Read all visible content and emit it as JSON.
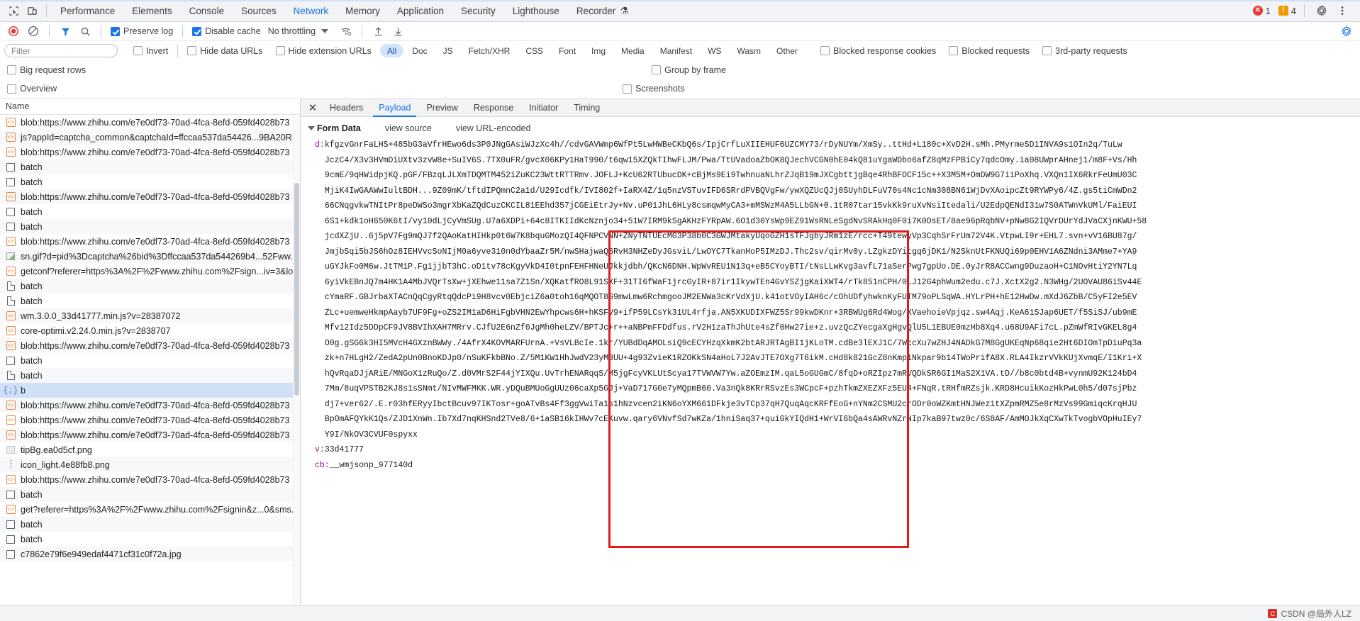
{
  "topbar": {
    "icons": [
      {
        "name": "inspect-element-icon",
        "glyph": "⬚"
      },
      {
        "name": "device-toolbar-icon",
        "glyph": "▯"
      }
    ],
    "tabs": [
      {
        "label": "Performance",
        "active": false
      },
      {
        "label": "Elements",
        "active": false
      },
      {
        "label": "Console",
        "active": false
      },
      {
        "label": "Sources",
        "active": false
      },
      {
        "label": "Network",
        "active": true
      },
      {
        "label": "Memory",
        "active": false
      },
      {
        "label": "Application",
        "active": false
      },
      {
        "label": "Security",
        "active": false
      },
      {
        "label": "Lighthouse",
        "active": false
      },
      {
        "label": "Recorder",
        "active": false,
        "flask": "⚗"
      }
    ],
    "error_count": "1",
    "warning_count": "4",
    "settings_icon": "gear-icon",
    "more_icon": "more-vertical-icon"
  },
  "toolbar": {
    "record_icon": "record-button",
    "clear_icon": "clear-network-log-icon",
    "filter_icon": "filter-icon",
    "search_icon": "search-icon",
    "preserve_log_label": "Preserve log",
    "preserve_log_checked": true,
    "disable_cache_label": "Disable cache",
    "disable_cache_checked": true,
    "throttle_value": "No throttling",
    "network_conditions_icon": "wifi-settings-icon",
    "import_har_icon": "import-har-icon",
    "export_har_icon": "export-har-icon",
    "settings_icon": "network-settings-icon"
  },
  "filters": {
    "placeholder": "Filter",
    "invert_label": "Invert",
    "invert_checked": false,
    "hide_data_urls_label": "Hide data URLs",
    "hide_data_urls_checked": false,
    "hide_extension_urls_label": "Hide extension URLs",
    "hide_extension_urls_checked": false,
    "types": [
      {
        "label": "All",
        "active": true
      },
      {
        "label": "Doc",
        "active": false
      },
      {
        "label": "JS",
        "active": false
      },
      {
        "label": "Fetch/XHR",
        "active": false
      },
      {
        "label": "CSS",
        "active": false
      },
      {
        "label": "Font",
        "active": false
      },
      {
        "label": "Img",
        "active": false
      },
      {
        "label": "Media",
        "active": false
      },
      {
        "label": "Manifest",
        "active": false
      },
      {
        "label": "WS",
        "active": false
      },
      {
        "label": "Wasm",
        "active": false
      },
      {
        "label": "Other",
        "active": false
      }
    ],
    "blocked_response_cookies_label": "Blocked response cookies",
    "blocked_response_cookies_checked": false,
    "blocked_requests_label": "Blocked requests",
    "blocked_requests_checked": false,
    "third_party_requests_label": "3rd-party requests",
    "third_party_requests_checked": false,
    "big_request_rows_label": "Big request rows",
    "big_request_rows_checked": false,
    "group_by_frame_label": "Group by frame",
    "group_by_frame_checked": false,
    "overview_label": "Overview",
    "overview_checked": false,
    "screenshots_label": "Screenshots",
    "screenshots_checked": false
  },
  "requests": {
    "column_header": "Name",
    "rows": [
      {
        "name": "blob:https://www.zhihu.com/e7e0df73-70ad-4fca-8efd-059fd4028b73",
        "icon": "js-file-icon",
        "selected": false
      },
      {
        "name": "js?appId=captcha_common&captchaId=ffccaa537da54426...9BA20R...",
        "icon": "js-file-icon",
        "selected": false
      },
      {
        "name": "blob:https://www.zhihu.com/e7e0df73-70ad-4fca-8efd-059fd4028b73",
        "icon": "js-file-icon",
        "selected": false
      },
      {
        "name": "batch",
        "icon": "square-icon",
        "selected": false
      },
      {
        "name": "batch",
        "icon": "square-icon",
        "selected": false
      },
      {
        "name": "blob:https://www.zhihu.com/e7e0df73-70ad-4fca-8efd-059fd4028b73",
        "icon": "js-file-icon",
        "selected": false
      },
      {
        "name": "batch",
        "icon": "square-icon",
        "selected": false
      },
      {
        "name": "batch",
        "icon": "square-icon",
        "selected": false
      },
      {
        "name": "blob:https://www.zhihu.com/e7e0df73-70ad-4fca-8efd-059fd4028b73",
        "icon": "js-file-icon",
        "selected": false
      },
      {
        "name": "sn.gif?d=pid%3Dcaptcha%26bid%3Dffccaa537da544269b4...52Fww...",
        "icon": "image-file-icon",
        "selected": false
      },
      {
        "name": "getconf?referer=https%3A%2F%2Fwww.zhihu.com%2Fsign...iv=3&lo...",
        "icon": "js-file-icon",
        "selected": false
      },
      {
        "name": "batch",
        "icon": "doc-file-icon",
        "selected": false
      },
      {
        "name": "batch",
        "icon": "doc-file-icon",
        "selected": false
      },
      {
        "name": "wm.3.0.0_33d41777.min.js?v=28387072",
        "icon": "js-file-icon",
        "selected": false
      },
      {
        "name": "core-optimi.v2.24.0.min.js?v=2838707",
        "icon": "js-file-icon",
        "selected": false
      },
      {
        "name": "blob:https://www.zhihu.com/e7e0df73-70ad-4fca-8efd-059fd4028b73",
        "icon": "js-file-icon",
        "selected": false
      },
      {
        "name": "batch",
        "icon": "square-icon",
        "selected": false
      },
      {
        "name": "batch",
        "icon": "doc-file-icon",
        "selected": false
      },
      {
        "name": "b",
        "icon": "websocket-icon",
        "selected": true
      },
      {
        "name": "blob:https://www.zhihu.com/e7e0df73-70ad-4fca-8efd-059fd4028b73",
        "icon": "js-file-icon",
        "selected": false
      },
      {
        "name": "blob:https://www.zhihu.com/e7e0df73-70ad-4fca-8efd-059fd4028b73",
        "icon": "js-file-icon",
        "selected": false
      },
      {
        "name": "blob:https://www.zhihu.com/e7e0df73-70ad-4fca-8efd-059fd4028b73",
        "icon": "js-file-icon",
        "selected": false
      },
      {
        "name": "tipBg.ea0d5cf.png",
        "icon": "picture-file-icon",
        "selected": false
      },
      {
        "name": "icon_light.4e88fb8.png",
        "icon": "dots-file-icon",
        "selected": false
      },
      {
        "name": "blob:https://www.zhihu.com/e7e0df73-70ad-4fca-8efd-059fd4028b73",
        "icon": "js-file-icon",
        "selected": false
      },
      {
        "name": "batch",
        "icon": "square-icon",
        "selected": false
      },
      {
        "name": "get?referer=https%3A%2F%2Fwww.zhihu.com%2Fsignin&z...0&sms...",
        "icon": "js-file-icon",
        "selected": false
      },
      {
        "name": "batch",
        "icon": "square-icon",
        "selected": false
      },
      {
        "name": "batch",
        "icon": "square-icon",
        "selected": false
      },
      {
        "name": "c7862e79f6e949edaf4471cf31c0f72a.jpg",
        "icon": "square-icon",
        "selected": false
      }
    ]
  },
  "details": {
    "close_icon": "close-icon",
    "tabs": [
      {
        "label": "Headers",
        "active": false
      },
      {
        "label": "Payload",
        "active": true
      },
      {
        "label": "Preview",
        "active": false
      },
      {
        "label": "Response",
        "active": false
      },
      {
        "label": "Initiator",
        "active": false
      },
      {
        "label": "Timing",
        "active": false
      }
    ],
    "form_data_title": "Form Data",
    "view_source_label": "view source",
    "view_url_encoded_label": "view URL-encoded",
    "fields": [
      {
        "key": "d:",
        "lines": [
          "kfgzvGnrFaLHS+485bG3aVfrHEwo6ds3P0JNgGAsiWJzXc4h//cdvGAVWmp6WfPt5LwHWBeCKbQ6s/IpjCrfLuXIIEHUF6UZCMY73/rDyNUYm/XmSy..ttHd+L180c+XvD2H.sMh.PMyrmeSD1INVA9s1OIn2q/TuLw",
          "JczC4/X3v3HVmDiUXtv3zvW8e+SuIV6S.7TX0uFR/gvcX06KPy1HaT990/t6qw15XZQkTIhwFLJM/Pwa/TtUVadoaZbOK8QJechVCGN0hE04kQ81uYgaWDbo6afZ8qMzFPBiCy7qdcOmy.ia08UWprAHnej1/m8F+Vs/Hh",
          "9cmE/9qHWidpjKQ.pGF/FBzqLJLXmTDQMTM452iZuKC23WttRTTRmv.JOFLJ+KcU62RTUbucDK+cBjMs9Ei9TwhnuaNLhrZJqB19mJXCgbttjgBqe4RhBFOCF15c++X3M5M+OmDW9G7iiPoXhq.VXQn1IX6RkrFeUmU03C",
          "MjiK4IwGAAWwIultBDH...9Z09mK/tftdIPQmnC2a1d/U29Icdfk/IVI802f+IaRX4Z/1q5nzVSTuvIFD6SRrdPVBQVgFw/ywXQZUcQJj0SUyhDLFuV70s4Nc1cNm308BN61WjDvXAoipcZt9RYWPy6/4Z.gs5tiCmWDn2",
          "66CNqgvkwTNItPr8peDWSo3mgrXbKaZQdCuzCKCIL81EEhd357jCGEiEtrJy+Nv.uP01JhL6HLy8csmqwMyCA3+mMSWzM4A5LLbGN+0.1tR07tar15vkKk9ruXvNsiItedali/U2EdpQENdI31w7S0ATWnVkUMl/FaiEUI",
          "6S1+kdk1oH650K6tI/vy10dLjCyVmSUg.U7a6XDPi+64c8ITKIIdKcNznjo34+51W7IRM9kSgAKHzFYRpAW.6O1d30YsWp9EZ91WsRNLeSgdNvSRAkHq0F0i7K0OsET/8ae96pRqbNV+pNw8G2IQVrDUrYdJVaCXjnKWU+58",
          "jcdXZjU..6j5pV7Fg9mQJ7f2QAoKatHIHkp0t6W7K8bquGMozQI4QFNPCVNN+ZNyTNTUEcMG3P38b0C3GWJMtakyUqoGZH1sTFJgbyJRm1zE/rcc+T49tewyVp3CqhSrFrUm72V4K.VtpwLI9r+EHL7.svn+vV16BU87g/",
          "JmjbSqi5bJS6hOz8IEHVvcSoNIjM0a6yve310n0dYbaaZr5M/nwSHajwaQ6RvH3NHZeDyJGsviL/LwOYC7TkanHoP5IMzDJ.Thc2sv/qirMv0y.LZgkzDYitgq6jDK1/N2SknUtFKNUQi69p0EHV1A6ZNdni3AMme7+YA9",
          "uGYJkFo0M6w.JtTM1P.Fg1jjbT3hC.oD1tv78cKgyVkD4I0tpnFEHFHNeUJkkjdbh/QKcN6DNH.WpWvREU1N13q+eB5CYoyBTI/tNsLLwKvg3avfL71aSerPwg7gpUo.DE.0yJrR8ACCwng9DuzaoH+C1NOvHtiY2YN7Lq",
          "6yiVkEBnJQ7m4HK1A4MbJVQrTsXw+jXEhwe11sa7Z1Sn/XQKatfRO8L91SXF+31TI6fWaF1jrcGyIR+87ir1IkywTEn4GvYSZjgKaiXWT4/rTk851nCPH/0LJ12G4phWum2edu.c7J.XctX2g2.N3WHg/2UOVAU86iSv44E",
          "cYmaRF.GBJrbaXTACnQqCgyRtqQdcPi9H8vcv0EbjciZ6a0toh16qMQOT8S9mwLmw6RchmgooJM2ENWa3cKrVdXjU.k41otVOyIAH6c/cOhUDfyhwknKyFUTM79oPLSqWA.HYLrPH+hE12HwDw.mXdJ6ZbB/C5yFI2e5EV",
          "ZLc+uemweHkmpAayb7UF9Fg+oZS2IM1aD6HiFgbVHN2EwYhpcws6H+hKSFV9+ifP59LCsYk31UL4rfja.AN5XKUDIXFWZ5Sr99kwDKnr+3RBWUg6Rd4Wog/XVaehoieVpjqz.sw4Aqj.KeA61SJap6UET/f5SiSJ/ub9mE",
          "Mfv12Idz5DDpCF9JV8BVIhXAH7MRrv.CJfU2E6nZf0JgMh0heLZV/BPTJc+r++aNBPmFFDdfus.rV2H1zaThJhUte4sZf0Hw27ie+z.uvzQcZYecgaXgHgvQlU5L1EBUE0mzHb8Xq4.u68U9AFi7cL.pZmWfRIvGKEL8g4",
          "O0g.gSG6k3HI5MVcH4GXznBWWy./4AfrX4KOVMARFUrnA.+VsVLBcIe.1kr/YUBdDqAMOLsiQ9cECYHzqXkmK2btARJRTAgBI1jKLoTM.cdBe3lEXJ1C/7WccXu7wZHJ4NADkG7M8GgUKEqNp68qie2Ht6DIOmTpDiuPq3a",
          "zk+n7HLgH2/ZedA2pUn0BnoKDJp0/nSuKFkbBNo.Z/5M1KW1HhJwdV23yM8UU+4g93ZvieK1RZOKkSN4aHoL7J2AvJTE7OXg7T6ikM.cHd8k821GcZ8nKmp1Nkpar9b14TWoPrifA8X.RLA4IkzrVVkKUjXvmqE/I1Kri+X",
          "hQvRqaDJjARiE/MNGoX1zRuQo/Z.d0VMrS2F44jYIXQu.UvTrhENARqqS/M5jgFcyVKLUtScya17TVWVW7Yw.aZOEmzIM.qaL5oGUGmC/8fqD+oRZIpz7mRVQDkSR6GI1MaS2X1VA.tD//b8c0btd4B+vynmU92K124bD4",
          "7Mm/8uqVPSTB2KJ8s1sSNmt/NIvMWFMKK.WR.yDQuBMUoGgUUz06caXp5GJj+VaD717G0e7yMQpmB60.Va3nQk8KRrRSvzEs3WCpcF+pzhTkmZXEZXFz5EU4+FNqR.tRHfmRZsjk.KRD8HcuikKozHkPwL0h5/d07sjPbz",
          "dj7+ver62/.E.r03hfERyyIbctBcuv97IKTosr+goATvBs4Ff3ggVwiTa1s1hNzvcen2iKN6oYXM661DFkje3vTCp37qH7QuqAqcKRFfEoG+nYNm2CSMU2crODr0oWZKmtHNJWezitXZpmRMZ5e8rMzVs99GmiqcKrqHJU",
          "BpOmAFQYkK1Qs/ZJD1XnWn.Ib7Xd7nqKHSnd2TVe8/6+1aSB16kIHWv7cEKuvw.qary6VNvfSd7wKZa/1hniSaq37+quiGkYIQdH1+WrVI6bQa4sAWRvNZrNIp7kaB97twz0c/6S8AF/AmMOJkXqCXwTkTvogbVOpHuIEy7",
          "Y9I/NkOV3CVUF0spyxx"
        ]
      },
      {
        "key": "v:",
        "lines": [
          "33d41777"
        ]
      },
      {
        "key": "cb:",
        "lines": [
          "__wmjsonp_977140d"
        ]
      }
    ]
  },
  "statusbar": {
    "watermark": "CSDN @局外人LZ"
  }
}
